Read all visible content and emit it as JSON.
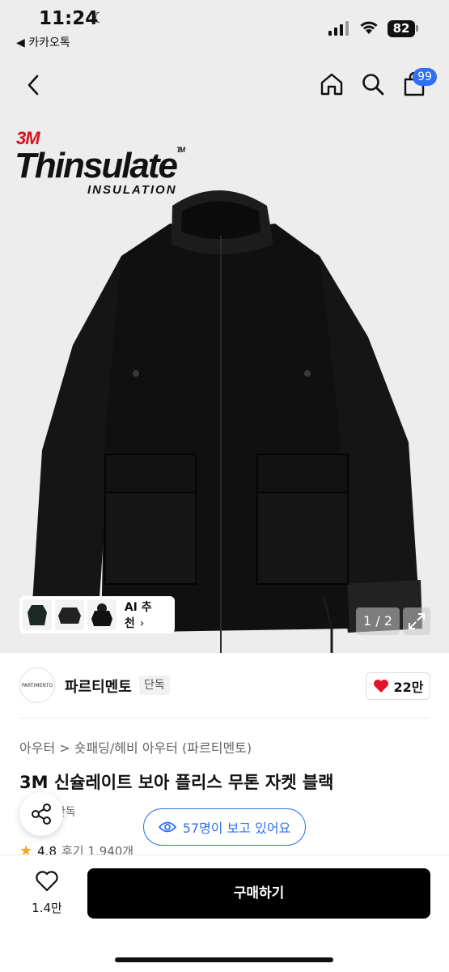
{
  "status": {
    "time": "11:24",
    "back_app": "◀ 카카오톡",
    "battery": "82"
  },
  "header": {
    "cart_count": "99"
  },
  "hero": {
    "brand_3m": "3M",
    "brand_thinsulate": "Thinsulate",
    "brand_tm": "TM",
    "brand_insulation": "INSULATION",
    "ai_recommend": "AI 추천",
    "ai_arrow": "›",
    "page_counter": "1 / 2"
  },
  "brand": {
    "logo_text": "PARTIMENTO",
    "name": "파르티멘토",
    "exclusive": "단독",
    "likes": "22만"
  },
  "product": {
    "breadcrumb": "아우터 > 숏패딩/헤비 아우터 (파르티멘토)",
    "title": "3M 신슐레이트 보아 플리스 무톤 자켓 블랙",
    "exclusive_tag": "단독",
    "viewers": "57명이 보고 있어요",
    "rating": "4.8",
    "reviews": "후기 1,940개"
  },
  "bottom": {
    "wish_count": "1.4만",
    "buy_label": "구매하기"
  },
  "colors": {
    "accent": "#2f6ff3",
    "brand_red": "#d2141d",
    "heart": "#e5132b",
    "star": "#f5a623"
  }
}
